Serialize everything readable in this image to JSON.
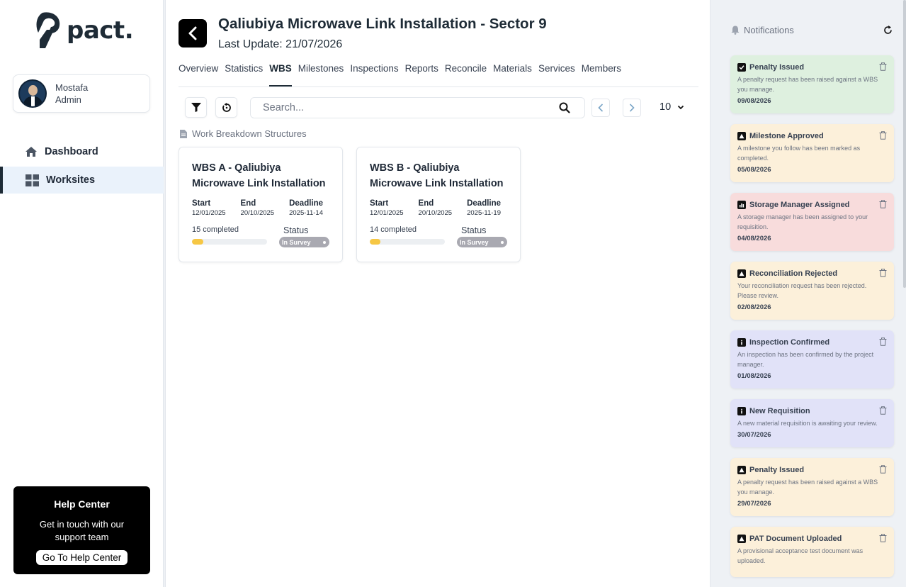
{
  "brand": {
    "name": "pact."
  },
  "user": {
    "name": "Mostafa",
    "role": "Admin"
  },
  "nav": {
    "items": [
      {
        "label": "Dashboard",
        "icon": "home-icon",
        "active": false
      },
      {
        "label": "Worksites",
        "icon": "grid-icon",
        "active": true
      }
    ]
  },
  "help": {
    "title": "Help Center",
    "text": "Get in touch with our support team",
    "button": "Go To Help Center"
  },
  "project": {
    "title": "Qaliubiya Microwave Link Installation - Sector 9",
    "last_update": "Last Update: 21/07/2026"
  },
  "tabs": [
    "Overview",
    "Statistics",
    "WBS",
    "Milestones",
    "Inspections",
    "Reports",
    "Reconcile",
    "Materials",
    "Services",
    "Members"
  ],
  "active_tab": "WBS",
  "toolbar": {
    "search_placeholder": "Search...",
    "page_size": "10"
  },
  "section_label": "Work Breakdown Structures",
  "wbs_cards": [
    {
      "title": "WBS A - Qaliubiya Microwave Link Installation",
      "start_label": "Start",
      "start": "12/01/2025",
      "end_label": "End",
      "end": "20/10/2025",
      "deadline_label": "Deadline",
      "deadline": "2025-11-14",
      "completed": "15 completed",
      "progress": 0.15,
      "status_label": "Status",
      "status": "In Survey"
    },
    {
      "title": "WBS B - Qaliubiya Microwave Link Installation",
      "start_label": "Start",
      "start": "12/01/2025",
      "end_label": "End",
      "end": "20/10/2025",
      "deadline_label": "Deadline",
      "deadline": "2025-11-19",
      "completed": "14 completed",
      "progress": 0.14,
      "status_label": "Status",
      "status": "In Survey"
    }
  ],
  "notifications": {
    "header": "Notifications",
    "items": [
      {
        "title": "Penalty Issued",
        "message": "A penalty request has been raised against a WBS you manage.",
        "date": "09/08/2026",
        "bg": "#def0df",
        "icon": "check-icon"
      },
      {
        "title": "Milestone Approved",
        "message": "A milestone you follow has been marked as completed.",
        "date": "05/08/2026",
        "bg": "#fcf0da",
        "icon": "warning-icon"
      },
      {
        "title": "Storage Manager Assigned",
        "message": "A storage manager has been assigned to your requisition.",
        "date": "04/08/2026",
        "bg": "#f8dcdc",
        "icon": "chart-icon"
      },
      {
        "title": "Reconciliation Rejected",
        "message": "Your reconciliation request has been rejected. Please review.",
        "date": "02/08/2026",
        "bg": "#fcf0da",
        "icon": "warning-icon"
      },
      {
        "title": "Inspection Confirmed",
        "message": "An inspection has been confirmed by the project manager.",
        "date": "01/08/2026",
        "bg": "#e1e2f8",
        "icon": "info-icon"
      },
      {
        "title": "New Requisition",
        "message": "A new material requisition is awaiting your review.",
        "date": "30/07/2026",
        "bg": "#e1e2f8",
        "icon": "info-icon"
      },
      {
        "title": "Penalty Issued",
        "message": "A penalty request has been raised against a WBS you manage.",
        "date": "29/07/2026",
        "bg": "#fcf0da",
        "icon": "warning-icon"
      },
      {
        "title": "PAT Document Uploaded",
        "message": "A provisional acceptance test document was uploaded.",
        "date": "",
        "bg": "#fcf0da",
        "icon": "warning-icon"
      }
    ]
  }
}
